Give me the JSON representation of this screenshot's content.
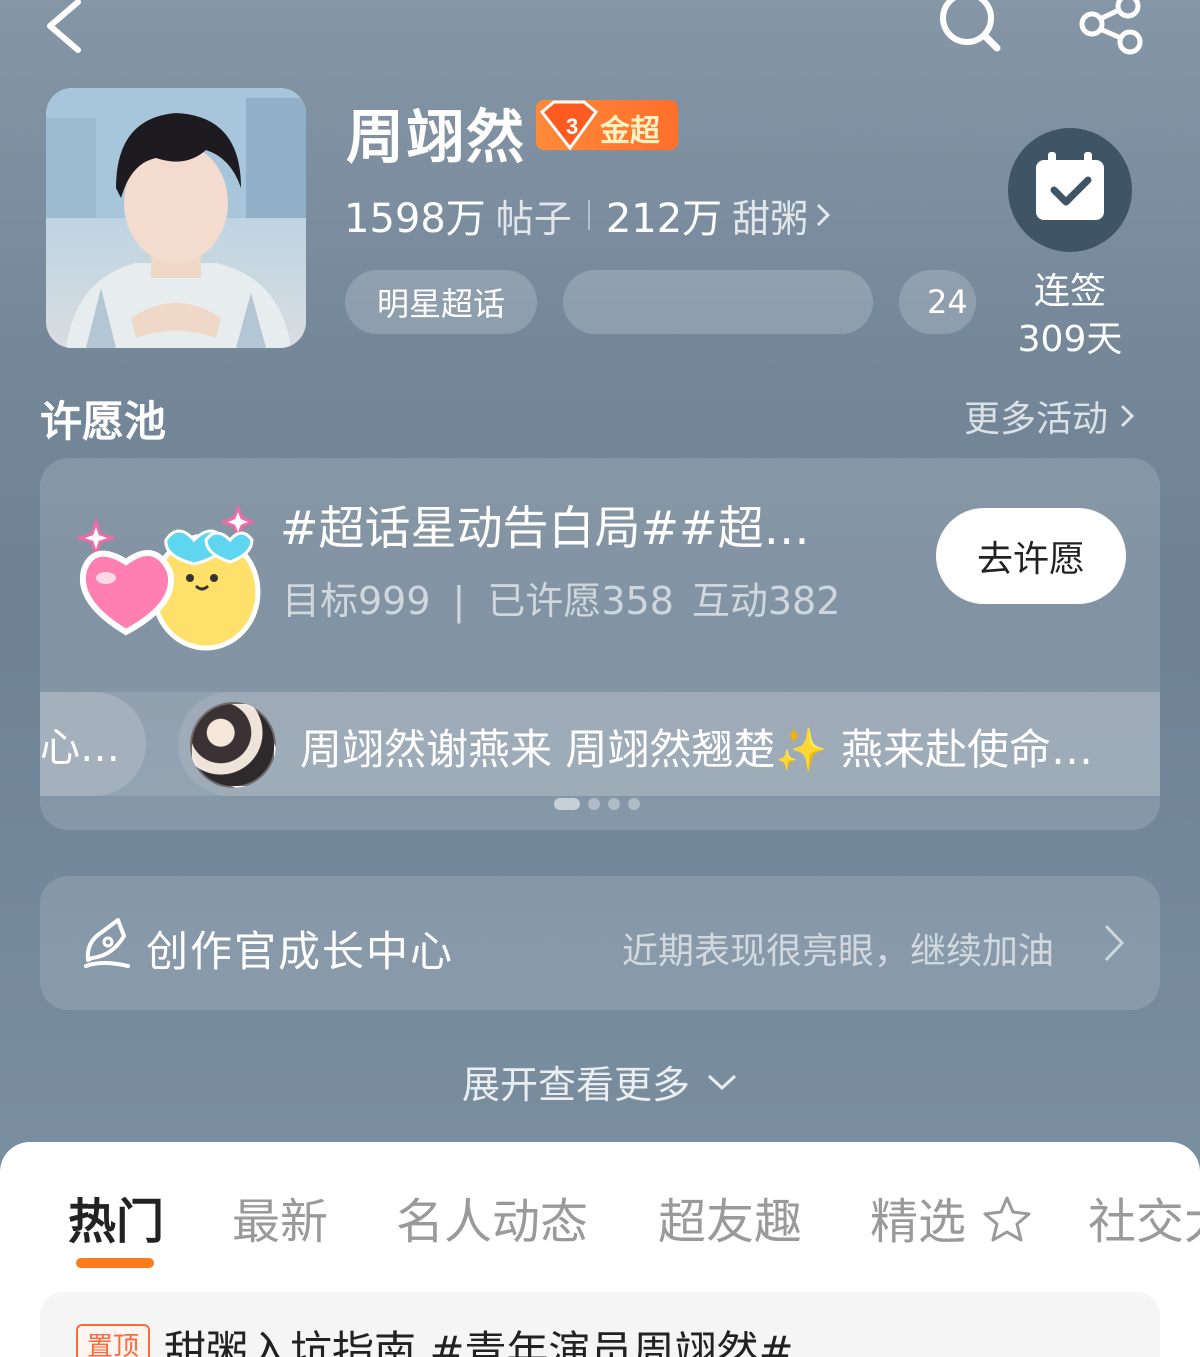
{
  "icons": {
    "back": "chevron-left-icon",
    "search": "search-icon",
    "share": "share-icon",
    "checkin": "calendar-check-icon",
    "creator": "quill-pen-icon"
  },
  "profile": {
    "name": "周翊然",
    "badge_label": "金超",
    "badge_level": "3",
    "posts_count": "1598万",
    "posts_label": "帖子",
    "fans_count": "212万",
    "fans_label": "甜粥",
    "tags": [
      "明星超话",
      "",
      "24"
    ]
  },
  "checkin": {
    "line1": "连签",
    "line2": "309天"
  },
  "wish_pool": {
    "title": "许愿池",
    "more": "更多活动",
    "card_title": "#超话星动告白局##超…",
    "target": "目标999",
    "divider": "|",
    "wished": "已许愿358",
    "interact": "互动382",
    "button": "去许愿",
    "prev_snippet": "心…",
    "snippet": "周翊然谢燕来 周翊然翘楚✨ 燕来赴使命…",
    "dots_total": 4,
    "dots_active": 0
  },
  "creator": {
    "title": "创作官成长中心",
    "subtitle": "近期表现很亮眼，继续加油"
  },
  "expand": {
    "label": "展开查看更多"
  },
  "tabs": [
    "热门",
    "最新",
    "名人动态",
    "超友趣",
    "精选",
    "社交大"
  ],
  "active_tab": 0,
  "pinned": {
    "tag": "置顶",
    "text": "甜粥入坑指南 #青年演员周翊然#"
  },
  "colors": {
    "accent": "#ff7a1a",
    "badge": "#ff7a2e",
    "checkin_bg": "#3f5566"
  }
}
